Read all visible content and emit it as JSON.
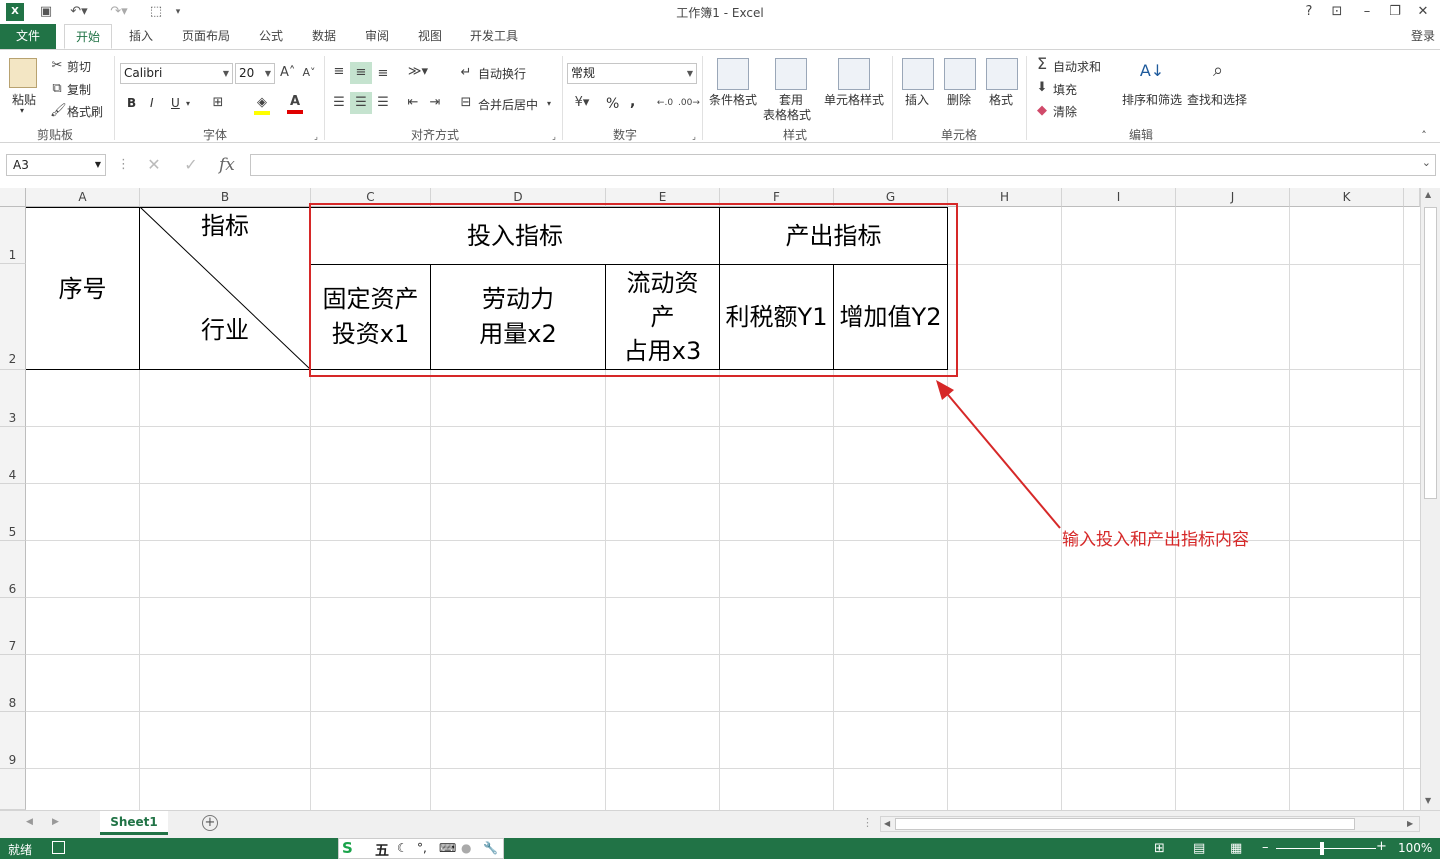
{
  "window": {
    "title": "工作簿1 - Excel",
    "help": "?",
    "signin": "登录"
  },
  "tabs": [
    "文件",
    "开始",
    "插入",
    "页面布局",
    "公式",
    "数据",
    "审阅",
    "视图",
    "开发工具"
  ],
  "ribbon": {
    "clipboard": {
      "paste": "粘贴",
      "cut": "剪切",
      "copy": "复制",
      "format_painter": "格式刷",
      "label": "剪贴板"
    },
    "font": {
      "name": "Calibri",
      "size": "20",
      "bold": "B",
      "italic": "I",
      "underline": "U",
      "label": "字体"
    },
    "alignment": {
      "wrap": "自动换行",
      "merge": "合并后居中",
      "label": "对齐方式"
    },
    "number": {
      "format": "常规",
      "percent": "%",
      "comma": ",",
      "label": "数字"
    },
    "styles": {
      "conditional": "条件格式",
      "table1": "套用",
      "table2": "表格格式",
      "cell_styles": "单元格样式",
      "label": "样式"
    },
    "cells": {
      "insert": "插入",
      "delete": "删除",
      "format": "格式",
      "label": "单元格"
    },
    "editing": {
      "autosum": "自动求和",
      "fill": "填充",
      "clear": "清除",
      "sort": "排序和筛选",
      "find": "查找和选择",
      "label": "编辑"
    }
  },
  "formula_bar": {
    "name_box": "A3",
    "fx": "fx"
  },
  "columns": [
    "A",
    "B",
    "C",
    "D",
    "E",
    "F",
    "G",
    "H",
    "I",
    "J",
    "K"
  ],
  "rows": [
    "1",
    "2",
    "3",
    "4",
    "5",
    "6",
    "7",
    "8",
    "9"
  ],
  "cells": {
    "a_merged": "序号",
    "b_top": "指标",
    "b_bottom": "行业",
    "input_header": "投入指标",
    "output_header": "产出指标",
    "c2_l1": "固定资产",
    "c2_l2": "投资x1",
    "d2_l1": "劳动力",
    "d2_l2": "用量x2",
    "e2_l1": "流动资",
    "e2_l2": "产",
    "e2_l3": "占用x3",
    "f2": "利税额Y1",
    "g2": "增加值Y2"
  },
  "annotation": "输入投入和产出指标内容",
  "sheet_tab": "Sheet1",
  "status": {
    "ready": "就绪",
    "zoom": "100%",
    "ime": "五"
  },
  "colors": {
    "excel_green": "#217346",
    "annotation_red": "#d62828"
  }
}
